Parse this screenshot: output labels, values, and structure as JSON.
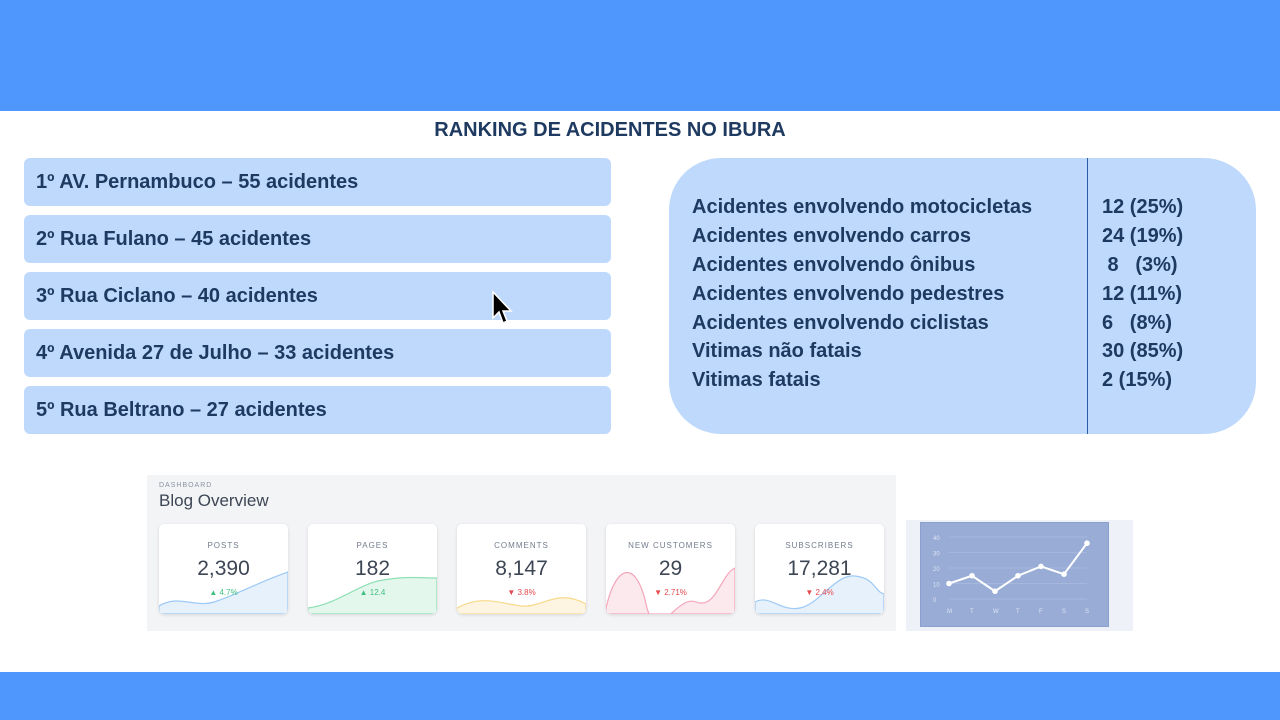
{
  "title": "RANKING DE ACIDENTES NO IBURA",
  "ranking": [
    "1º AV. Pernambuco – 55 acidentes",
    "2º Rua Fulano – 45 acidentes",
    "3º Rua Ciclano – 40 acidentes",
    "4º Avenida 27 de Julho – 33 acidentes",
    "5º Rua Beltrano – 27 acidentes"
  ],
  "stats": [
    {
      "label": "Acidentes envolvendo motocicletas",
      "value": "12 (25%)"
    },
    {
      "label": "Acidentes envolvendo carros",
      "value": "24 (19%)"
    },
    {
      "label": "Acidentes envolvendo ônibus",
      "value": " 8   (3%)"
    },
    {
      "label": "Acidentes envolvendo pedestres",
      "value": "12 (11%)"
    },
    {
      "label": "Acidentes envolvendo ciclistas",
      "value": "6   (8%)"
    },
    {
      "label": "Vitimas não fatais",
      "value": "30 (85%)"
    },
    {
      "label": "Vitimas fatais",
      "value": "2 (15%)"
    }
  ],
  "dashboard": {
    "kicker": "DASHBOARD",
    "title": "Blog Overview",
    "cards": [
      {
        "label": "POSTS",
        "value": "2,390",
        "change": "▲ 4.7%",
        "trend": "up",
        "color": "#9dc9f5"
      },
      {
        "label": "PAGES",
        "value": "182",
        "change": "▲ 12.4",
        "trend": "up",
        "color": "#8ee0b4"
      },
      {
        "label": "COMMENTS",
        "value": "8,147",
        "change": "▼ 3.8%",
        "trend": "down",
        "color": "#f7d98a"
      },
      {
        "label": "NEW CUSTOMERS",
        "value": "29",
        "change": "▼ 2.71%",
        "trend": "down",
        "color": "#f3a6b9"
      },
      {
        "label": "SUBSCRIBERS",
        "value": "17,281",
        "change": "▼ 2.4%",
        "trend": "down",
        "color": "#9dc9f5"
      }
    ]
  },
  "mini_chart": {
    "y_ticks": [
      "40",
      "30",
      "20",
      "10",
      "0"
    ],
    "x_labels": [
      "M",
      "T",
      "W",
      "T",
      "F",
      "S",
      "S"
    ],
    "values": [
      10,
      15,
      5,
      15,
      21,
      16,
      36
    ]
  },
  "colors": {
    "up": "#3fbf7f",
    "down": "#e5484d",
    "accent": "#4f97fd"
  }
}
